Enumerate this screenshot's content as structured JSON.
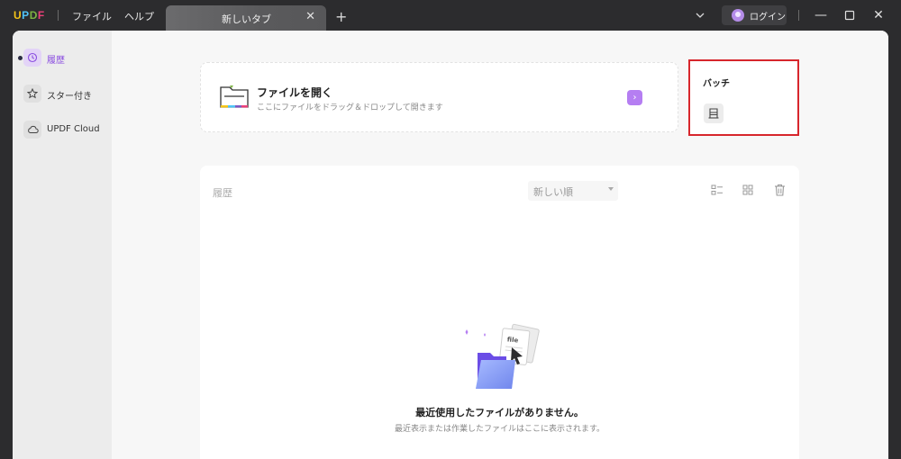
{
  "titlebar": {
    "logo": "UPDF",
    "menu": [
      "ファイル",
      "ヘルプ"
    ],
    "tab_title": "新しいタブ",
    "tab_close": "✕",
    "tab_add": "+",
    "login_label": "ログイン",
    "minimize": "—",
    "close": "✕"
  },
  "sidebar": {
    "items": [
      {
        "label": "履歴",
        "icon": "clock-icon",
        "active": true
      },
      {
        "label": "スター付き",
        "icon": "star-icon",
        "active": false
      },
      {
        "label": "UPDF Cloud",
        "icon": "cloud-icon",
        "active": false
      }
    ]
  },
  "open_file": {
    "title": "ファイルを開く",
    "subtitle": "ここにファイルをドラッグ＆ドロップして開きます",
    "arrow": "›"
  },
  "batch": {
    "title": "バッチ"
  },
  "history": {
    "title": "履歴",
    "sort_value": "新しい順",
    "empty_title": "最近使用したファイルがありません。",
    "empty_subtitle": "最近表示または作業したファイルはここに表示されます。"
  },
  "colors": {
    "accent": "#8a4de0",
    "arrow_button": "#b57ef2",
    "highlight_border": "#d7262c",
    "titlebar": "#2c2c2e"
  }
}
